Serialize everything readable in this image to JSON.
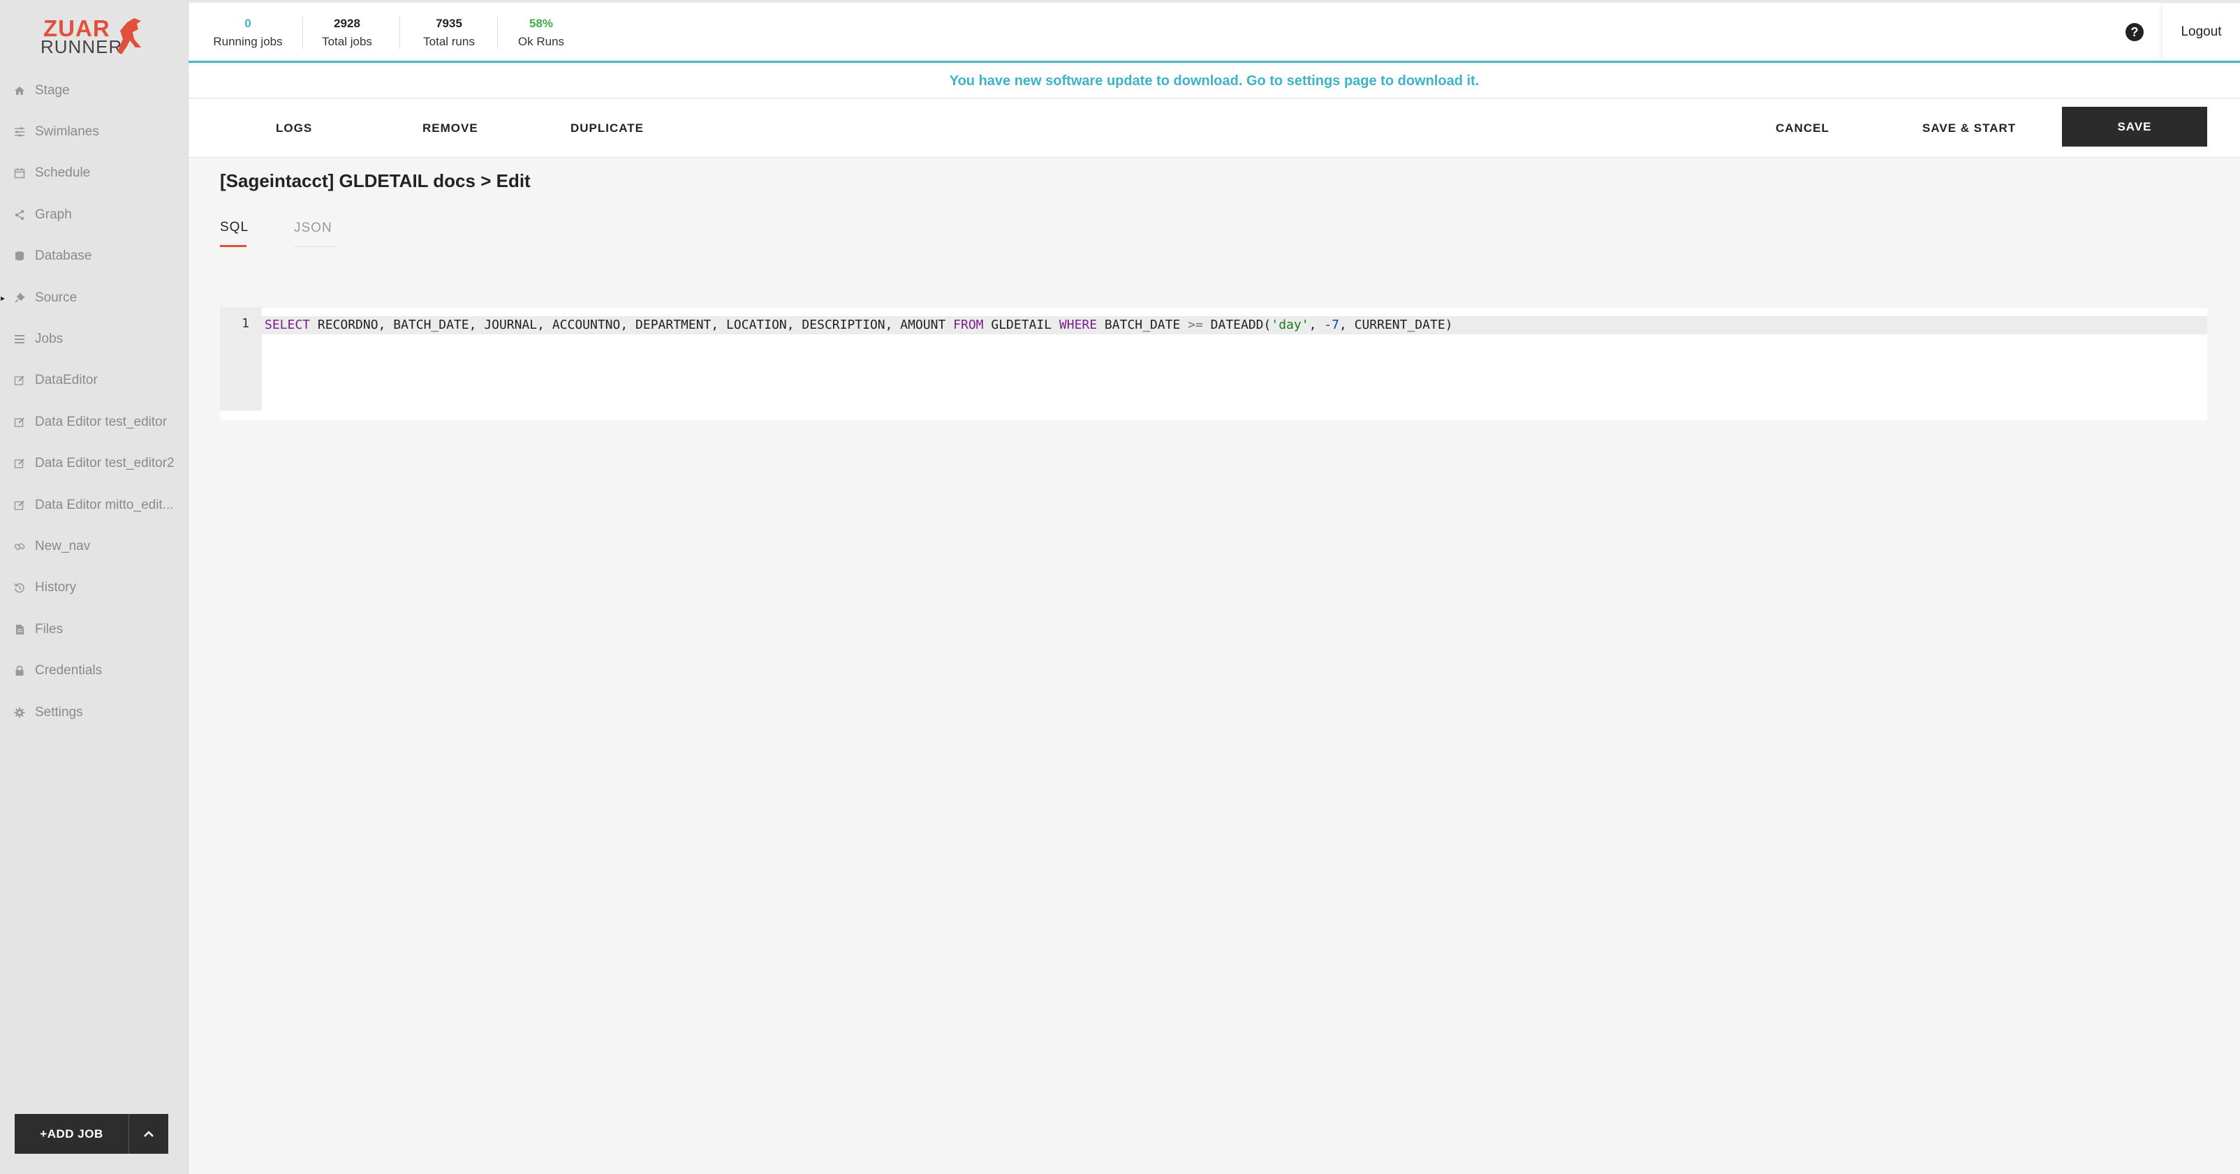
{
  "brand": {
    "line1": "ZUAR",
    "line2": "RUNNER"
  },
  "sidebar": {
    "items": [
      {
        "label": "Stage",
        "icon": "home-icon"
      },
      {
        "label": "Swimlanes",
        "icon": "sliders-icon"
      },
      {
        "label": "Schedule",
        "icon": "calendar-icon"
      },
      {
        "label": "Graph",
        "icon": "share-icon"
      },
      {
        "label": "Database",
        "icon": "database-icon"
      },
      {
        "label": "Source",
        "icon": "plug-icon"
      },
      {
        "label": "Jobs",
        "icon": "list-icon"
      },
      {
        "label": "DataEditor",
        "icon": "edit-icon"
      },
      {
        "label": "Data Editor test_editor",
        "icon": "edit-icon"
      },
      {
        "label": "Data Editor test_editor2",
        "icon": "edit-icon"
      },
      {
        "label": "Data Editor mitto_edit...",
        "icon": "edit-icon"
      },
      {
        "label": "New_nav",
        "icon": "link-icon"
      },
      {
        "label": "History",
        "icon": "history-icon"
      },
      {
        "label": "Files",
        "icon": "file-icon"
      },
      {
        "label": "Credentials",
        "icon": "lock-icon"
      },
      {
        "label": "Settings",
        "icon": "gear-icon"
      }
    ],
    "add_job_label": "+ADD JOB"
  },
  "stats": {
    "running_jobs": {
      "value": "0",
      "label": "Running jobs",
      "color": "#3db3c8"
    },
    "total_jobs": {
      "value": "2928",
      "label": "Total jobs"
    },
    "total_runs": {
      "value": "7935",
      "label": "Total runs"
    },
    "ok_runs": {
      "value": "58%",
      "label": "Ok Runs",
      "color": "#3cb043"
    }
  },
  "header": {
    "help_icon": "question-circle-icon",
    "logout_label": "Logout"
  },
  "banner": {
    "text": "You have new software update to download. Go to settings page to download it."
  },
  "actions": {
    "logs": "LOGS",
    "remove": "REMOVE",
    "duplicate": "DUPLICATE",
    "cancel": "CANCEL",
    "save_start": "SAVE & START",
    "save": "SAVE"
  },
  "page": {
    "title": "[Sageintacct] GLDETAIL docs > Edit",
    "tabs": [
      {
        "label": "SQL",
        "active": true
      },
      {
        "label": "JSON",
        "active": false
      }
    ]
  },
  "editor": {
    "line_number": "1",
    "tokens": {
      "t01": "SELECT",
      "t02": " RECORDNO, BATCH_DATE, JOURNAL, ACCOUNTNO, DEPARTMENT, LOCATION, DESCRIPTION, AMOUNT ",
      "t03": "FROM",
      "t04": " GLDETAIL ",
      "t05": "WHERE",
      "t06": " BATCH_DATE ",
      "t07": ">=",
      "t08": " DATEADD(",
      "t09": "'day'",
      "t10": ", ",
      "t11": "-7",
      "t12": ", CURRENT_DATE)"
    }
  },
  "colors": {
    "accent": "#e0503a",
    "teal": "#3db3c8",
    "dark_button": "#2b2b2b"
  }
}
